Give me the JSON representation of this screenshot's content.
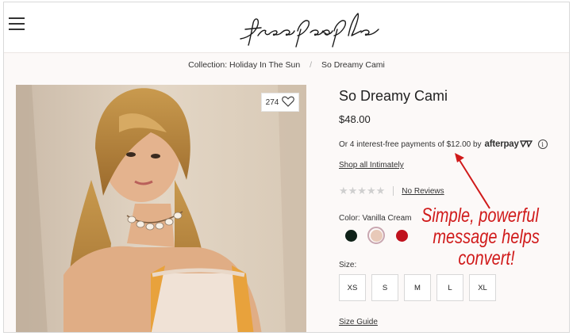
{
  "header": {
    "menu_icon": "hamburger-menu-icon",
    "logo_text": "free people"
  },
  "breadcrumb": {
    "collection": "Collection: Holiday In The Sun",
    "separator": "/",
    "current": "So Dreamy Cami"
  },
  "product": {
    "title": "So Dreamy Cami",
    "price": "$48.00",
    "wishlist_count": "274",
    "afterpay_text": "Or 4 interest-free payments of $12.00 by",
    "afterpay_brand": "afterpay",
    "afterpay_info_icon": "i",
    "shop_link": "Shop all Intimately",
    "stars": "★★★★★",
    "rating": 0,
    "reviews_link": "No Reviews",
    "color_label": "Color: Vanilla Cream",
    "swatches": [
      {
        "name": "Black",
        "color": "#0f2118",
        "selected": false
      },
      {
        "name": "Vanilla Cream",
        "color": "#e8c9b8",
        "selected": true
      },
      {
        "name": "Red",
        "color": "#c0121e",
        "selected": false
      }
    ],
    "size_label": "Size:",
    "sizes": [
      "XS",
      "S",
      "M",
      "L",
      "XL"
    ],
    "size_guide": "Size Guide"
  },
  "annotation": {
    "lines": [
      "Simple, powerful",
      "message helps",
      "convert!"
    ],
    "color": "#d01a1a"
  }
}
